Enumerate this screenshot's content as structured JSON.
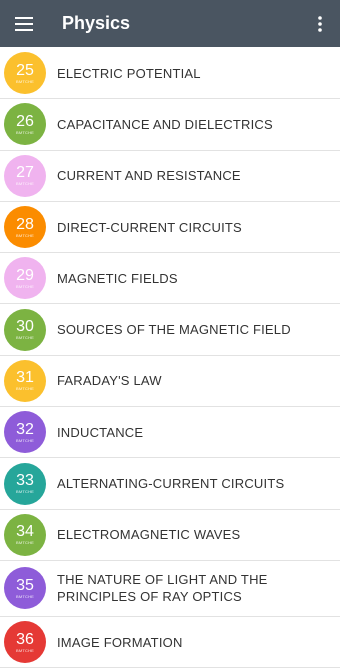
{
  "header": {
    "title": "Physics",
    "menu_icon": "hamburger-menu-icon",
    "more_icon": "more-vertical-icon"
  },
  "colors": {
    "app_bar": "#4a5561"
  },
  "chapters": [
    {
      "number": "25",
      "sub": "BMTCHE",
      "title": "ELECTRIC POTENTIAL",
      "color": "#fbc02d"
    },
    {
      "number": "26",
      "sub": "BMTCHE",
      "title": "CAPACITANCE AND DIELECTRICS",
      "color": "#7cb342"
    },
    {
      "number": "27",
      "sub": "BMTCHE",
      "title": "CURRENT AND RESISTANCE",
      "color": "#f0b3ef"
    },
    {
      "number": "28",
      "sub": "BMTCHE",
      "title": "DIRECT-CURRENT CIRCUITS",
      "color": "#fb8c00"
    },
    {
      "number": "29",
      "sub": "BMTCHE",
      "title": "MAGNETIC FIELDS",
      "color": "#f0b3ef"
    },
    {
      "number": "30",
      "sub": "BMTCHE",
      "title": "SOURCES OF THE MAGNETIC FIELD",
      "color": "#7cb342"
    },
    {
      "number": "31",
      "sub": "BMTCHE",
      "title": "FARADAY'S LAW",
      "color": "#fbc02d"
    },
    {
      "number": "32",
      "sub": "BMTCHE",
      "title": "INDUCTANCE",
      "color": "#8e5cd9"
    },
    {
      "number": "33",
      "sub": "BMTCHE",
      "title": "ALTERNATING-CURRENT CIRCUITS",
      "color": "#26a69a"
    },
    {
      "number": "34",
      "sub": "BMTCHE",
      "title": "ELECTROMAGNETIC WAVES",
      "color": "#7cb342"
    },
    {
      "number": "35",
      "sub": "BMTCHE",
      "title": "THE NATURE OF LIGHT AND THE PRINCIPLES OF RAY OPTICS",
      "color": "#8e5cd9"
    },
    {
      "number": "36",
      "sub": "BMTCHE",
      "title": "IMAGE FORMATION",
      "color": "#e53935"
    }
  ]
}
